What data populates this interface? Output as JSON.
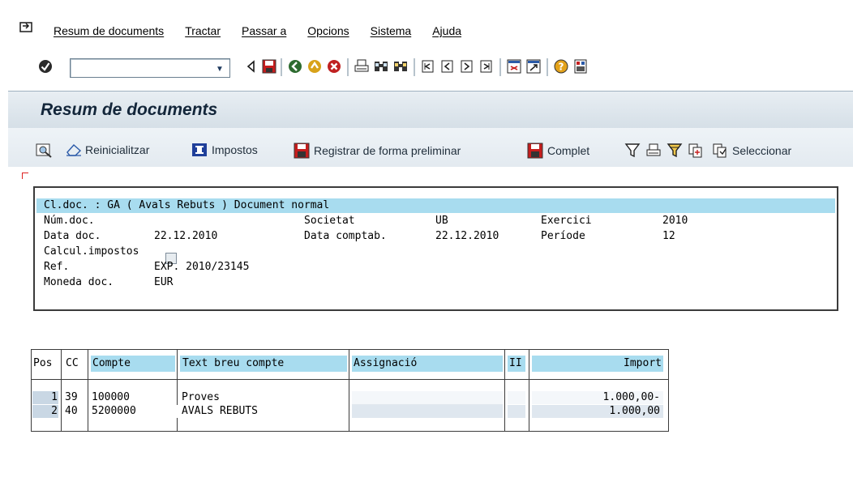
{
  "menubar": {
    "items": [
      "Resum de documents",
      "Tractar",
      "Passar a",
      "Opcions",
      "Sistema",
      "Ajuda"
    ]
  },
  "toolbar": {
    "command_value": "",
    "icons": [
      "enter-icon",
      "back-icon",
      "save-icon",
      "back-nav-icon",
      "exit-icon",
      "cancel-icon",
      "print-icon",
      "find-icon",
      "find-next-icon",
      "first-page-icon",
      "prev-page-icon",
      "next-page-icon",
      "last-page-icon",
      "new-session-icon",
      "shortcut-icon",
      "help-icon",
      "layout-icon"
    ]
  },
  "title": "Resum de documents",
  "app_toolbar": {
    "reset_label": "Reinicialitzar",
    "taxes_label": "Impostos",
    "park_label": "Registrar de forma preliminar",
    "complete_label": "Complet",
    "select_label": "Seleccionar"
  },
  "header": {
    "line1": "Cl.doc. : GA ( Avals Rebuts ) Document normal",
    "num_doc_label": "Núm.doc.",
    "num_doc_value": "",
    "societat_label": "Societat",
    "societat_value": "UB",
    "exercici_label": "Exercici",
    "exercici_value": "2010",
    "data_doc_label": "Data doc.",
    "data_doc_value": "22.12.2010",
    "data_comptab_label": "Data comptab.",
    "data_comptab_value": "22.12.2010",
    "periode_label": "Període",
    "periode_value": "12",
    "calcul_label": "Calcul.impostos",
    "calcul_checked": false,
    "ref_label": "Ref.",
    "ref_value": "EXP. 2010/23145",
    "moneda_label": "Moneda doc.",
    "moneda_value": "EUR"
  },
  "table": {
    "headers": {
      "pos": "Pos",
      "cc": "CC",
      "compte": "Compte",
      "text": "Text breu compte",
      "assignacio": "Assignació",
      "ii": "II",
      "import": "Import"
    },
    "rows": [
      {
        "pos": "1",
        "cc": "39",
        "compte": "100000",
        "text": "Proves",
        "assignacio": "",
        "ii": "",
        "import": "1.000,00-"
      },
      {
        "pos": "2",
        "cc": "40",
        "compte": "5200000",
        "text": "AVALS REBUTS",
        "assignacio": "",
        "ii": "",
        "import": "1.000,00"
      }
    ]
  },
  "colors": {
    "header_highlight": "#a8dcef",
    "row_shade": "#dfe7ef",
    "title_color": "#13263a"
  }
}
